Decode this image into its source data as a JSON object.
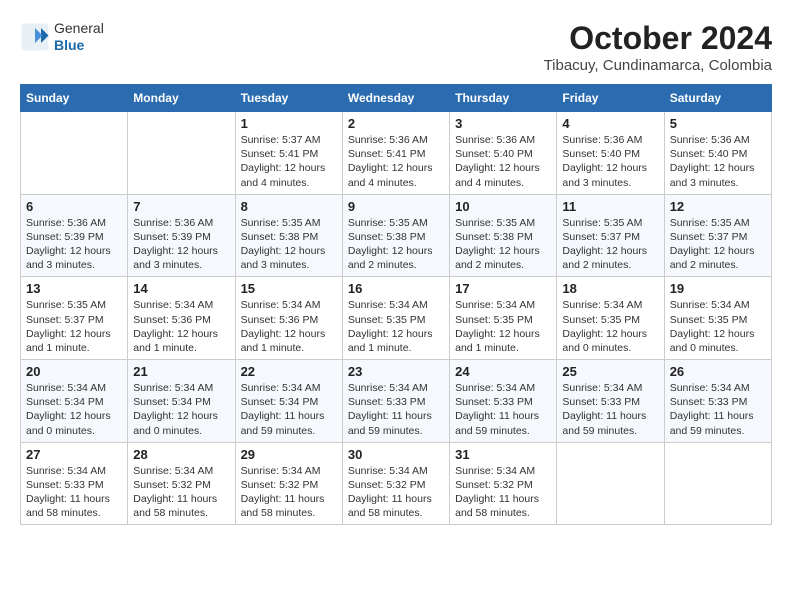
{
  "header": {
    "logo_general": "General",
    "logo_blue": "Blue",
    "title": "October 2024",
    "location": "Tibacuy, Cundinamarca, Colombia"
  },
  "weekdays": [
    "Sunday",
    "Monday",
    "Tuesday",
    "Wednesday",
    "Thursday",
    "Friday",
    "Saturday"
  ],
  "weeks": [
    [
      {
        "day": "",
        "sunrise": "",
        "sunset": "",
        "daylight": ""
      },
      {
        "day": "",
        "sunrise": "",
        "sunset": "",
        "daylight": ""
      },
      {
        "day": "1",
        "sunrise": "Sunrise: 5:37 AM",
        "sunset": "Sunset: 5:41 PM",
        "daylight": "Daylight: 12 hours and 4 minutes."
      },
      {
        "day": "2",
        "sunrise": "Sunrise: 5:36 AM",
        "sunset": "Sunset: 5:41 PM",
        "daylight": "Daylight: 12 hours and 4 minutes."
      },
      {
        "day": "3",
        "sunrise": "Sunrise: 5:36 AM",
        "sunset": "Sunset: 5:40 PM",
        "daylight": "Daylight: 12 hours and 4 minutes."
      },
      {
        "day": "4",
        "sunrise": "Sunrise: 5:36 AM",
        "sunset": "Sunset: 5:40 PM",
        "daylight": "Daylight: 12 hours and 3 minutes."
      },
      {
        "day": "5",
        "sunrise": "Sunrise: 5:36 AM",
        "sunset": "Sunset: 5:40 PM",
        "daylight": "Daylight: 12 hours and 3 minutes."
      }
    ],
    [
      {
        "day": "6",
        "sunrise": "Sunrise: 5:36 AM",
        "sunset": "Sunset: 5:39 PM",
        "daylight": "Daylight: 12 hours and 3 minutes."
      },
      {
        "day": "7",
        "sunrise": "Sunrise: 5:36 AM",
        "sunset": "Sunset: 5:39 PM",
        "daylight": "Daylight: 12 hours and 3 minutes."
      },
      {
        "day": "8",
        "sunrise": "Sunrise: 5:35 AM",
        "sunset": "Sunset: 5:38 PM",
        "daylight": "Daylight: 12 hours and 3 minutes."
      },
      {
        "day": "9",
        "sunrise": "Sunrise: 5:35 AM",
        "sunset": "Sunset: 5:38 PM",
        "daylight": "Daylight: 12 hours and 2 minutes."
      },
      {
        "day": "10",
        "sunrise": "Sunrise: 5:35 AM",
        "sunset": "Sunset: 5:38 PM",
        "daylight": "Daylight: 12 hours and 2 minutes."
      },
      {
        "day": "11",
        "sunrise": "Sunrise: 5:35 AM",
        "sunset": "Sunset: 5:37 PM",
        "daylight": "Daylight: 12 hours and 2 minutes."
      },
      {
        "day": "12",
        "sunrise": "Sunrise: 5:35 AM",
        "sunset": "Sunset: 5:37 PM",
        "daylight": "Daylight: 12 hours and 2 minutes."
      }
    ],
    [
      {
        "day": "13",
        "sunrise": "Sunrise: 5:35 AM",
        "sunset": "Sunset: 5:37 PM",
        "daylight": "Daylight: 12 hours and 1 minute."
      },
      {
        "day": "14",
        "sunrise": "Sunrise: 5:34 AM",
        "sunset": "Sunset: 5:36 PM",
        "daylight": "Daylight: 12 hours and 1 minute."
      },
      {
        "day": "15",
        "sunrise": "Sunrise: 5:34 AM",
        "sunset": "Sunset: 5:36 PM",
        "daylight": "Daylight: 12 hours and 1 minute."
      },
      {
        "day": "16",
        "sunrise": "Sunrise: 5:34 AM",
        "sunset": "Sunset: 5:35 PM",
        "daylight": "Daylight: 12 hours and 1 minute."
      },
      {
        "day": "17",
        "sunrise": "Sunrise: 5:34 AM",
        "sunset": "Sunset: 5:35 PM",
        "daylight": "Daylight: 12 hours and 1 minute."
      },
      {
        "day": "18",
        "sunrise": "Sunrise: 5:34 AM",
        "sunset": "Sunset: 5:35 PM",
        "daylight": "Daylight: 12 hours and 0 minutes."
      },
      {
        "day": "19",
        "sunrise": "Sunrise: 5:34 AM",
        "sunset": "Sunset: 5:35 PM",
        "daylight": "Daylight: 12 hours and 0 minutes."
      }
    ],
    [
      {
        "day": "20",
        "sunrise": "Sunrise: 5:34 AM",
        "sunset": "Sunset: 5:34 PM",
        "daylight": "Daylight: 12 hours and 0 minutes."
      },
      {
        "day": "21",
        "sunrise": "Sunrise: 5:34 AM",
        "sunset": "Sunset: 5:34 PM",
        "daylight": "Daylight: 12 hours and 0 minutes."
      },
      {
        "day": "22",
        "sunrise": "Sunrise: 5:34 AM",
        "sunset": "Sunset: 5:34 PM",
        "daylight": "Daylight: 11 hours and 59 minutes."
      },
      {
        "day": "23",
        "sunrise": "Sunrise: 5:34 AM",
        "sunset": "Sunset: 5:33 PM",
        "daylight": "Daylight: 11 hours and 59 minutes."
      },
      {
        "day": "24",
        "sunrise": "Sunrise: 5:34 AM",
        "sunset": "Sunset: 5:33 PM",
        "daylight": "Daylight: 11 hours and 59 minutes."
      },
      {
        "day": "25",
        "sunrise": "Sunrise: 5:34 AM",
        "sunset": "Sunset: 5:33 PM",
        "daylight": "Daylight: 11 hours and 59 minutes."
      },
      {
        "day": "26",
        "sunrise": "Sunrise: 5:34 AM",
        "sunset": "Sunset: 5:33 PM",
        "daylight": "Daylight: 11 hours and 59 minutes."
      }
    ],
    [
      {
        "day": "27",
        "sunrise": "Sunrise: 5:34 AM",
        "sunset": "Sunset: 5:33 PM",
        "daylight": "Daylight: 11 hours and 58 minutes."
      },
      {
        "day": "28",
        "sunrise": "Sunrise: 5:34 AM",
        "sunset": "Sunset: 5:32 PM",
        "daylight": "Daylight: 11 hours and 58 minutes."
      },
      {
        "day": "29",
        "sunrise": "Sunrise: 5:34 AM",
        "sunset": "Sunset: 5:32 PM",
        "daylight": "Daylight: 11 hours and 58 minutes."
      },
      {
        "day": "30",
        "sunrise": "Sunrise: 5:34 AM",
        "sunset": "Sunset: 5:32 PM",
        "daylight": "Daylight: 11 hours and 58 minutes."
      },
      {
        "day": "31",
        "sunrise": "Sunrise: 5:34 AM",
        "sunset": "Sunset: 5:32 PM",
        "daylight": "Daylight: 11 hours and 58 minutes."
      },
      {
        "day": "",
        "sunrise": "",
        "sunset": "",
        "daylight": ""
      },
      {
        "day": "",
        "sunrise": "",
        "sunset": "",
        "daylight": ""
      }
    ]
  ]
}
